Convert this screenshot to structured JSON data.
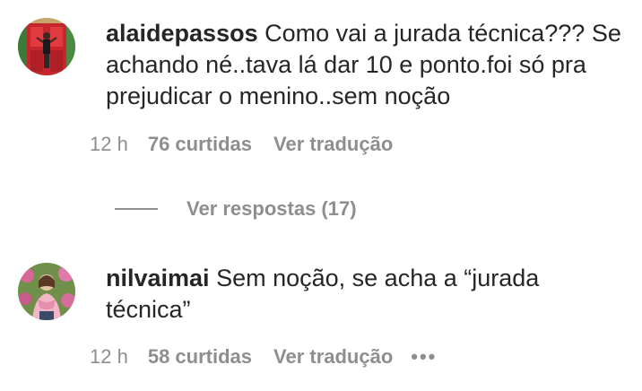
{
  "comments": [
    {
      "username": "alaidepassos",
      "text": "Como vai a jurada técnica??? Se achando né..tava lá dar 10 e ponto.foi só pra prejudicar o menino..sem noção",
      "time": "12 h",
      "likes": "76 curtidas",
      "translate": "Ver tradução",
      "avatar_icon": "profile-photo"
    },
    {
      "username": "nilvaimai",
      "text": "Sem noção, se acha a “jurada técnica”",
      "time": "12 h",
      "likes": "58 curtidas",
      "translate": "Ver tradução",
      "more": "•••",
      "avatar_icon": "profile-photo"
    }
  ],
  "replies": {
    "label": "Ver respostas (17)"
  },
  "colors": {
    "text": "#262626",
    "secondary": "#8e8e8e",
    "background": "#ffffff"
  }
}
